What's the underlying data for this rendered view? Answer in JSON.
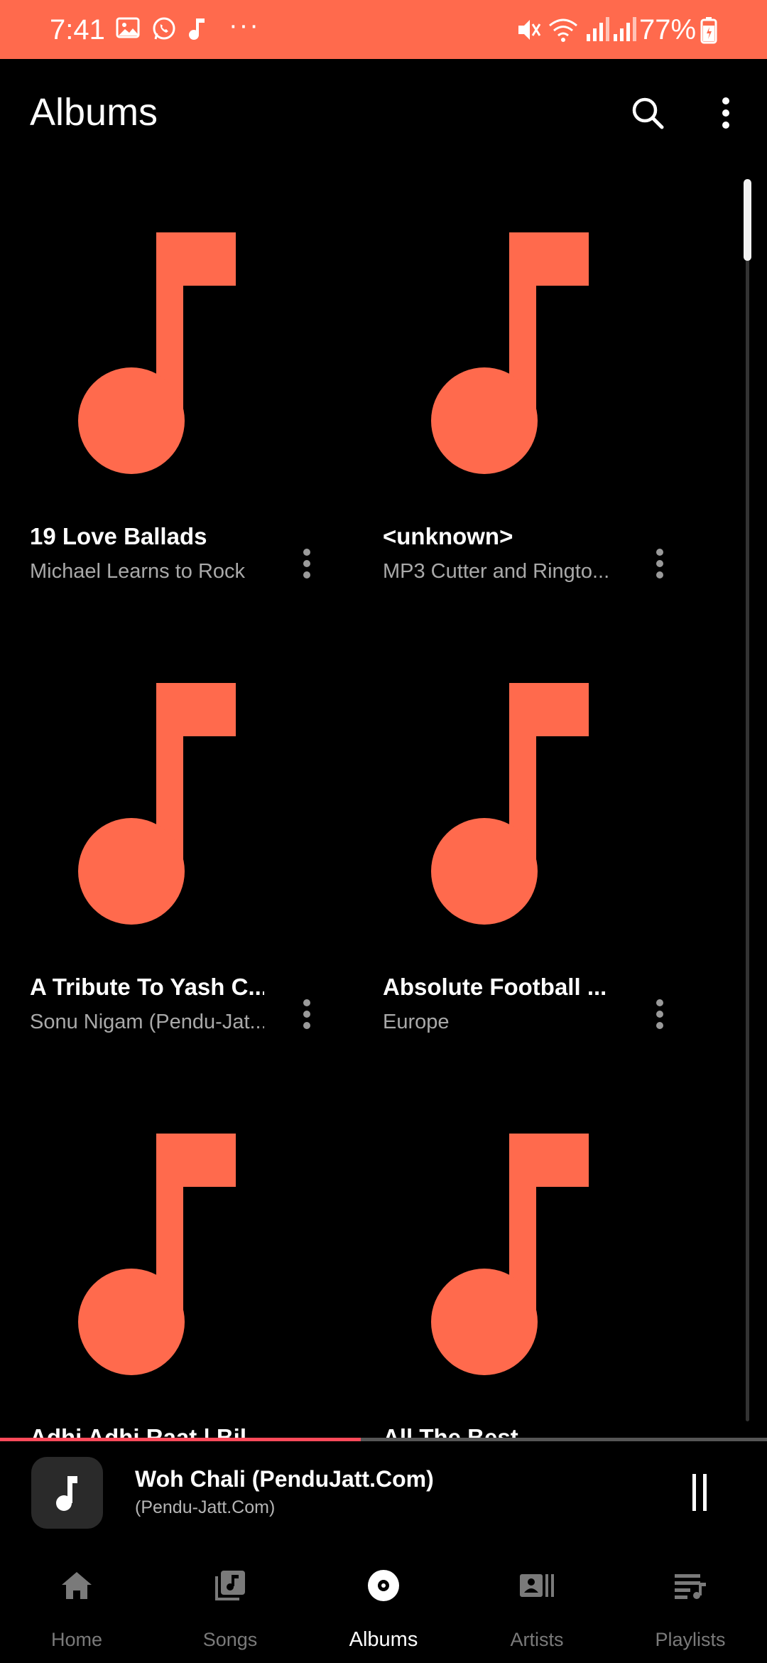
{
  "status_bar": {
    "time": "7:41",
    "notification_icons": [
      "gallery-icon",
      "whatsapp-icon",
      "music-note-icon"
    ],
    "more": "···",
    "system_icons": [
      "mute-icon",
      "wifi-icon",
      "signal-icon",
      "signal-icon"
    ],
    "battery": "77%",
    "color": "#ff6a4d"
  },
  "app_bar": {
    "title": "Albums",
    "search_icon": "search-icon",
    "menu_icon": "more-vert-icon"
  },
  "albums": [
    {
      "title": "19 Love Ballads",
      "artist": "Michael Learns to Rock"
    },
    {
      "title": "<unknown>",
      "artist": "MP3 Cutter and Ringto..."
    },
    {
      "title": "A Tribute To Yash C...",
      "artist": "Sonu Nigam (Pendu-Jat..."
    },
    {
      "title": "Absolute Football ...",
      "artist": "Europe"
    },
    {
      "title": "Adhi Adhi Raat | Bil...",
      "artist": ""
    },
    {
      "title": "All The Best",
      "artist": ""
    }
  ],
  "accent_color": "#ff6a4d",
  "mini_player": {
    "title": "Woh Chali (PenduJatt.Com)",
    "artist": "(Pendu-Jatt.Com)",
    "progress": 0.47,
    "pause_icon": "pause-icon"
  },
  "nav": [
    {
      "label": "Home",
      "icon": "home-icon",
      "active": false
    },
    {
      "label": "Songs",
      "icon": "songs-icon",
      "active": false
    },
    {
      "label": "Albums",
      "icon": "album-icon",
      "active": true
    },
    {
      "label": "Artists",
      "icon": "artists-icon",
      "active": false
    },
    {
      "label": "Playlists",
      "icon": "playlists-icon",
      "active": false
    }
  ]
}
